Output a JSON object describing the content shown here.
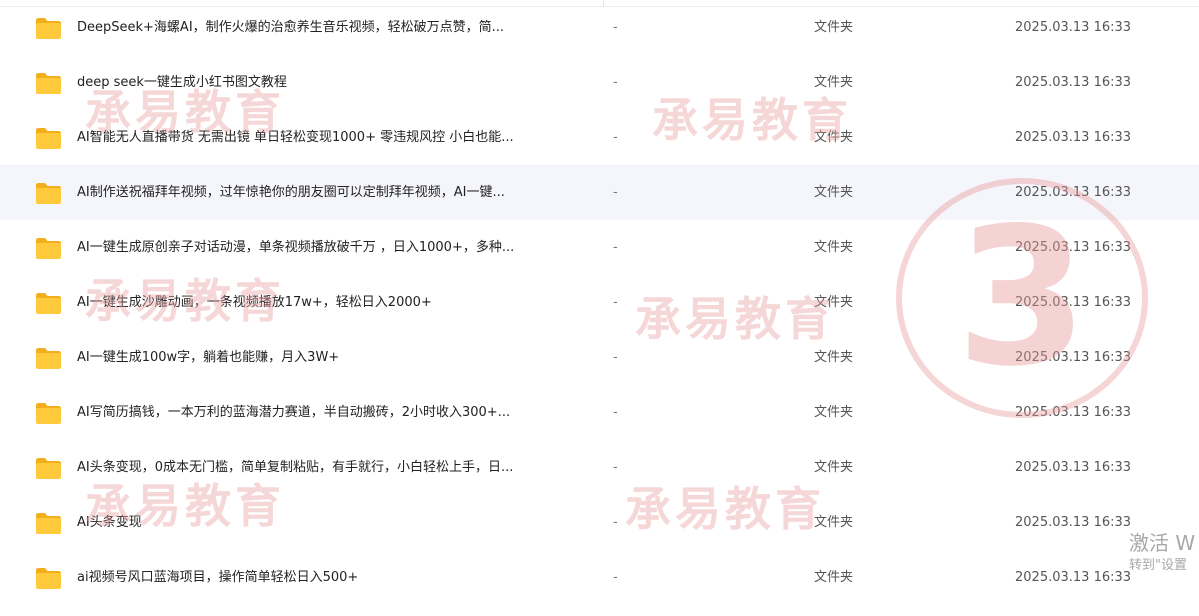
{
  "file_list": {
    "rows": [
      {
        "name": "DeepSeek+海螺AI，制作火爆的治愈养生音乐视频，轻松破万点赞，简...",
        "size": "-",
        "type": "文件夹",
        "date": "2025.03.13 16:33"
      },
      {
        "name": "deep seek一键生成小红书图文教程",
        "size": "-",
        "type": "文件夹",
        "date": "2025.03.13 16:33"
      },
      {
        "name": "AI智能无人直播带货 无需出镜 单日轻松变现1000+ 零违规风控 小白也能...",
        "size": "-",
        "type": "文件夹",
        "date": "2025.03.13 16:33"
      },
      {
        "name": "AI制作送祝福拜年视频，过年惊艳你的朋友圈可以定制拜年视频，AI一键...",
        "size": "-",
        "type": "文件夹",
        "date": "2025.03.13 16:33"
      },
      {
        "name": "AI一键生成原创亲子对话动漫，单条视频播放破千万 ，日入1000+，多种...",
        "size": "-",
        "type": "文件夹",
        "date": "2025.03.13 16:33"
      },
      {
        "name": "AI一键生成沙雕动画，一条视频播放17w+，轻松日入2000+",
        "size": "-",
        "type": "文件夹",
        "date": "2025.03.13 16:33"
      },
      {
        "name": "AI一键生成100w字，躺着也能赚，月入3W+",
        "size": "-",
        "type": "文件夹",
        "date": "2025.03.13 16:33"
      },
      {
        "name": "AI写简历搞钱，一本万利的蓝海潜力赛道，半自动搬砖，2小时收入300+...",
        "size": "-",
        "type": "文件夹",
        "date": "2025.03.13 16:33"
      },
      {
        "name": "AI头条变现，0成本无门槛，简单复制粘贴，有手就行，小白轻松上手，日...",
        "size": "-",
        "type": "文件夹",
        "date": "2025.03.13 16:33"
      },
      {
        "name": "AI头条变现",
        "size": "-",
        "type": "文件夹",
        "date": "2025.03.13 16:33"
      },
      {
        "name": "ai视频号风口蓝海项目，操作简单轻松日入500+",
        "size": "-",
        "type": "文件夹",
        "date": "2025.03.13 16:33"
      }
    ],
    "hovered_row": 3
  },
  "watermark": {
    "text": "承易教育",
    "badge_number": "3"
  },
  "activation": {
    "line1": "激活 W",
    "line2": "转到\"设置"
  },
  "colors": {
    "folder_body": "#FFC93C",
    "folder_tab": "#F2AE1C",
    "hover_row": "#F5F6FB",
    "watermark": "#E9A0A0"
  },
  "icons": {
    "row_icon": "folder-icon"
  }
}
